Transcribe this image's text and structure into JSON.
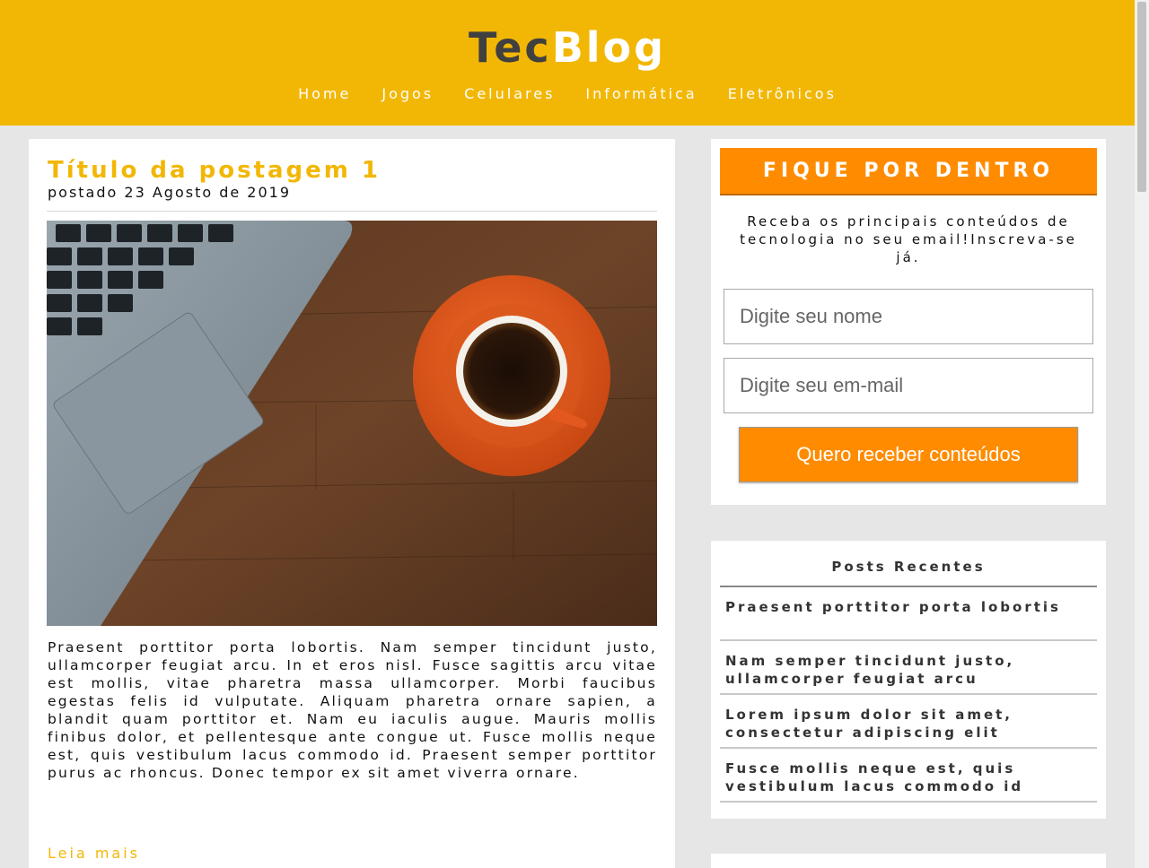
{
  "header": {
    "logo_part1": "Tec",
    "logo_part2": "Blog",
    "nav": [
      "Home",
      "Jogos",
      "Celulares",
      "Informática",
      "Eletrônicos"
    ]
  },
  "post": {
    "title": "Título da postagem 1",
    "date": "postado 23 Agosto de 2019",
    "body": "Praesent porttitor porta lobortis. Nam semper tincidunt justo, ullamcorper feugiat arcu. In et eros nisl. Fusce sagittis arcu vitae est mollis, vitae pharetra massa ullamcorper. Morbi faucibus egestas felis id vulputate. Aliquam pharetra ornare sapien, a blandit quam porttitor et. Nam eu iaculis augue. Mauris mollis finibus dolor, et pellentesque ante congue ut. Fusce mollis neque est, quis vestibulum lacus commodo id. Praesent semper porttitor purus ac rhoncus. Donec tempor ex sit amet viverra ornare.",
    "read_more": "Leia mais"
  },
  "newsletter": {
    "heading": "FIQUE POR DENTRO",
    "text": "Receba os principais conteúdos de tecnologia no seu email!Inscreva-se já.",
    "name_placeholder": "Digite seu nome",
    "email_placeholder": "Digite seu em-mail",
    "submit_label": "Quero receber conteúdos"
  },
  "recent": {
    "title": "Posts Recentes",
    "items": [
      "Praesent porttitor porta lobortis",
      "Nam semper tincidunt justo, ullamcorper feugiat arcu",
      "Lorem ipsum dolor sit amet, consectetur adipiscing elit",
      "Fusce mollis neque est, quis vestibulum lacus commodo id"
    ]
  },
  "colors": {
    "header_bg": "#f2b705",
    "accent_orange": "#ff8c00",
    "page_bg": "#e6e6e6"
  }
}
